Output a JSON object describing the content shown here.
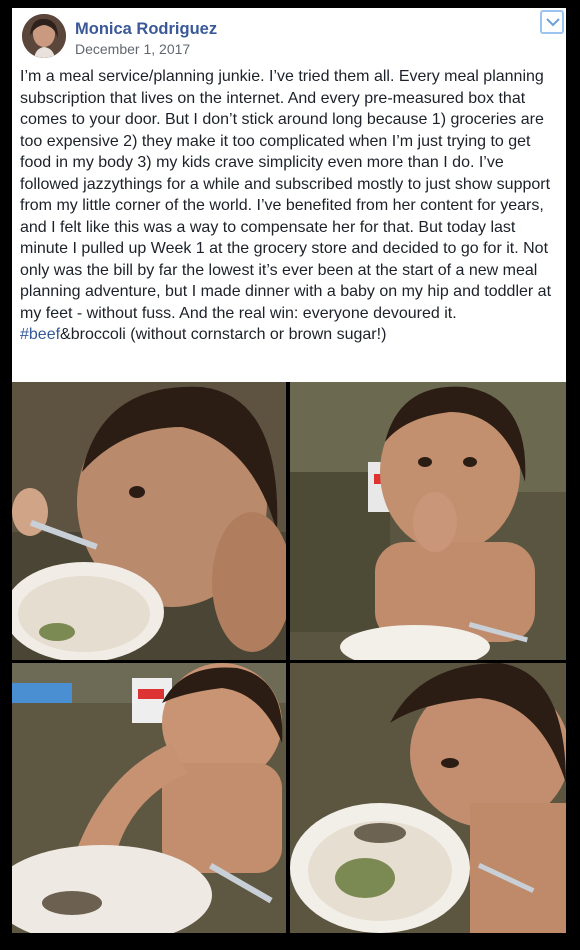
{
  "post": {
    "author": "Monica Rodriguez",
    "date": "December 1, 2017",
    "text_before": "I’m a meal service/planning junkie. I’ve tried them all. Every meal planning subscription that lives on the internet. And every pre-measured box that comes to your door. But I don’t stick around long because 1) groceries are too expensive 2) they make it too complicated when I’m just trying to get food in my body 3) my kids crave simplicity even more than I do. I’ve followed jazzythings for a while and subscribed mostly to just show support from my little corner of the world. I’ve benefited from her content for years, and I felt like this was a way to compensate her for that. But today last minute I pulled up Week 1 at the grocery store and decided to go for it. Not only was the bill by far the lowest it’s ever been at the start of a new meal planning adventure, but I made dinner with a baby on my hip and toddler at my feet - without fuss. And the real win: everyone devoured it. ",
    "hashtag": "#beef",
    "text_after": "&broccoli (without cornstarch or brown sugar!)"
  },
  "menu_icon": "chevron-down-icon",
  "colors": {
    "author": "#3b5998",
    "hashtag": "#365899",
    "background": "#000000"
  }
}
